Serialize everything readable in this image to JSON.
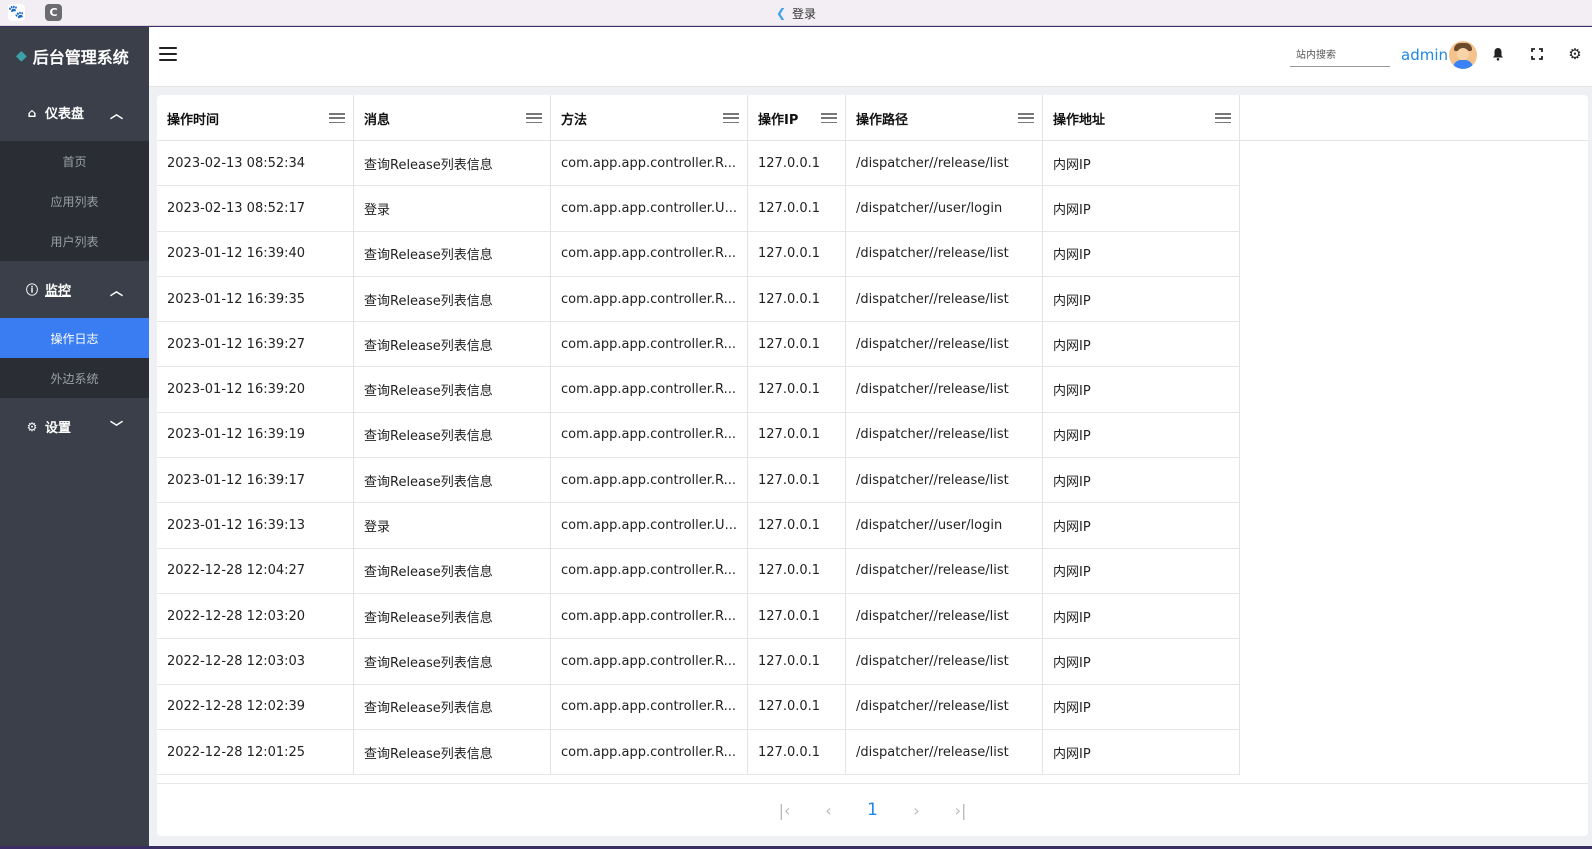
{
  "window": {
    "title": "登录",
    "tab_icon_c": "C"
  },
  "brand": {
    "title": "后台管理系统"
  },
  "sidebar": {
    "groups": [
      {
        "label": "仪表盘",
        "icon": "home-icon",
        "expanded": true,
        "items": [
          {
            "label": "首页"
          },
          {
            "label": "应用列表"
          },
          {
            "label": "用户列表"
          }
        ]
      },
      {
        "label": "监控",
        "icon": "info-icon",
        "expanded": true,
        "items": [
          {
            "label": "操作日志",
            "active": true
          },
          {
            "label": "外边系统"
          }
        ]
      },
      {
        "label": "设置",
        "icon": "gear-icon",
        "expanded": false,
        "items": []
      }
    ]
  },
  "header": {
    "search_placeholder": "站内搜索",
    "username": "admin"
  },
  "table": {
    "columns": [
      "操作时间",
      "消息",
      "方法",
      "操作IP",
      "操作路径",
      "操作地址"
    ],
    "rows": [
      [
        "2023-02-13 08:52:34",
        "查询Release列表信息",
        "com.app.app.controller.R...",
        "127.0.0.1",
        "/dispatcher//release/list",
        "内网IP"
      ],
      [
        "2023-02-13 08:52:17",
        "登录",
        "com.app.app.controller.U...",
        "127.0.0.1",
        "/dispatcher//user/login",
        "内网IP"
      ],
      [
        "2023-01-12 16:39:40",
        "查询Release列表信息",
        "com.app.app.controller.R...",
        "127.0.0.1",
        "/dispatcher//release/list",
        "内网IP"
      ],
      [
        "2023-01-12 16:39:35",
        "查询Release列表信息",
        "com.app.app.controller.R...",
        "127.0.0.1",
        "/dispatcher//release/list",
        "内网IP"
      ],
      [
        "2023-01-12 16:39:27",
        "查询Release列表信息",
        "com.app.app.controller.R...",
        "127.0.0.1",
        "/dispatcher//release/list",
        "内网IP"
      ],
      [
        "2023-01-12 16:39:20",
        "查询Release列表信息",
        "com.app.app.controller.R...",
        "127.0.0.1",
        "/dispatcher//release/list",
        "内网IP"
      ],
      [
        "2023-01-12 16:39:19",
        "查询Release列表信息",
        "com.app.app.controller.R...",
        "127.0.0.1",
        "/dispatcher//release/list",
        "内网IP"
      ],
      [
        "2023-01-12 16:39:17",
        "查询Release列表信息",
        "com.app.app.controller.R...",
        "127.0.0.1",
        "/dispatcher//release/list",
        "内网IP"
      ],
      [
        "2023-01-12 16:39:13",
        "登录",
        "com.app.app.controller.U...",
        "127.0.0.1",
        "/dispatcher//user/login",
        "内网IP"
      ],
      [
        "2022-12-28 12:04:27",
        "查询Release列表信息",
        "com.app.app.controller.R...",
        "127.0.0.1",
        "/dispatcher//release/list",
        "内网IP"
      ],
      [
        "2022-12-28 12:03:20",
        "查询Release列表信息",
        "com.app.app.controller.R...",
        "127.0.0.1",
        "/dispatcher//release/list",
        "内网IP"
      ],
      [
        "2022-12-28 12:03:03",
        "查询Release列表信息",
        "com.app.app.controller.R...",
        "127.0.0.1",
        "/dispatcher//release/list",
        "内网IP"
      ],
      [
        "2022-12-28 12:02:39",
        "查询Release列表信息",
        "com.app.app.controller.R...",
        "127.0.0.1",
        "/dispatcher//release/list",
        "内网IP"
      ],
      [
        "2022-12-28 12:01:25",
        "查询Release列表信息",
        "com.app.app.controller.R...",
        "127.0.0.1",
        "/dispatcher//release/list",
        "内网IP"
      ]
    ]
  },
  "pagination": {
    "current_page": "1"
  },
  "colors": {
    "accent": "#1e88e5",
    "active_menu": "#3a7df2",
    "sidebar_bg": "#3a3f4a",
    "submenu_bg": "#2a2d33"
  }
}
